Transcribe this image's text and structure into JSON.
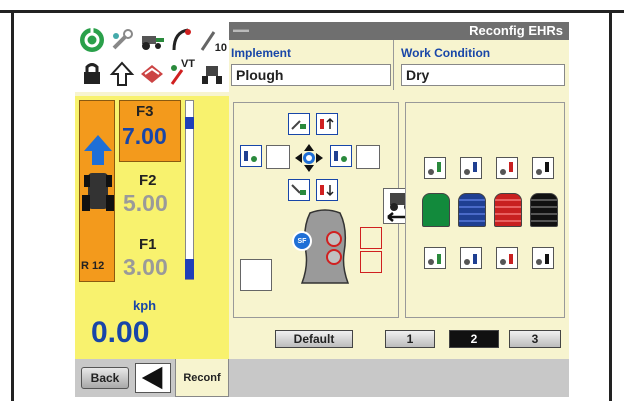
{
  "title": "Reconfig EHRs",
  "implement": {
    "label": "Implement",
    "value": "Plough"
  },
  "work_condition": {
    "label": "Work Condition",
    "value": "Dry"
  },
  "toolbar": {
    "vt_label": "VT",
    "ten_label": "10"
  },
  "transmission": {
    "gears": [
      {
        "name": "F3",
        "value": "7.00"
      },
      {
        "name": "F2",
        "value": "5.00"
      },
      {
        "name": "F1",
        "value": "3.00"
      }
    ],
    "reverse_gear": "R 12",
    "speed_unit": "kph",
    "speed": "0.00"
  },
  "buttons": {
    "default": "Default",
    "mem": [
      "1",
      "2",
      "3"
    ],
    "back": "Back",
    "reconf_tab": "Reconf"
  },
  "joystick": {
    "sf_label": "SF"
  },
  "colors": {
    "valve_green": "#128a3c",
    "valve_blue": "#1f3f92",
    "valve_red": "#c82020",
    "valve_black": "#111111",
    "accent_orange": "#f39a1c",
    "panel_yellow": "#f8f26e"
  }
}
